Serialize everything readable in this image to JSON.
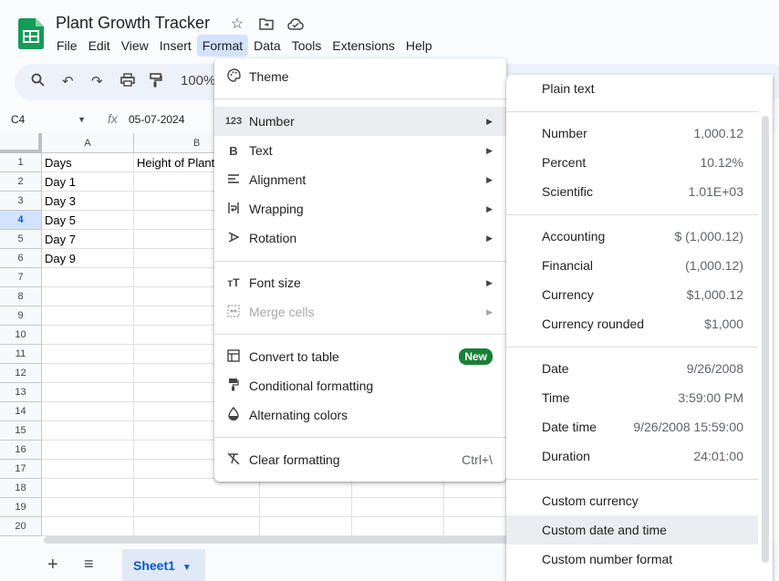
{
  "app": {
    "title": "Plant Growth Tracker",
    "menus": [
      "File",
      "Edit",
      "View",
      "Insert",
      "Format",
      "Data",
      "Tools",
      "Extensions",
      "Help"
    ],
    "active_menu": "Format",
    "brand_color": "#0f9d58"
  },
  "toolbar": {
    "zoom": "100%"
  },
  "formula_bar": {
    "cell_ref": "C4",
    "fx": "fx",
    "value": "05-07-2024"
  },
  "sheet": {
    "columns": [
      "A",
      "B"
    ],
    "rows": [
      "1",
      "2",
      "3",
      "4",
      "5",
      "6",
      "7",
      "8",
      "9",
      "10",
      "11",
      "12",
      "13",
      "14",
      "15",
      "16",
      "17",
      "18",
      "19",
      "20"
    ],
    "selected_row": "4",
    "cells": {
      "a1": "Days",
      "b1": "Height of Plant",
      "a2": "Day 1",
      "a3": "Day 3",
      "a4": "Day 5",
      "a5": "Day 7",
      "a6": "Day 9"
    }
  },
  "sheet_tabs": {
    "add": "+",
    "list": "≡",
    "active": "Sheet1"
  },
  "format_menu": {
    "theme": "Theme",
    "number": "Number",
    "text": "Text",
    "alignment": "Alignment",
    "wrapping": "Wrapping",
    "rotation": "Rotation",
    "font_size": "Font size",
    "merge_cells": "Merge cells",
    "convert_to_table": "Convert to table",
    "new_badge": "New",
    "conditional_formatting": "Conditional formatting",
    "alternating_colors": "Alternating colors",
    "clear_formatting": "Clear formatting",
    "clear_shortcut": "Ctrl+\\"
  },
  "number_submenu": {
    "plain_text": "Plain text",
    "number": {
      "label": "Number",
      "value": "1,000.12"
    },
    "percent": {
      "label": "Percent",
      "value": "10.12%"
    },
    "scientific": {
      "label": "Scientific",
      "value": "1.01E+03"
    },
    "accounting": {
      "label": "Accounting",
      "value": "$ (1,000.12)"
    },
    "financial": {
      "label": "Financial",
      "value": "(1,000.12)"
    },
    "currency": {
      "label": "Currency",
      "value": "$1,000.12"
    },
    "currency_rounded": {
      "label": "Currency rounded",
      "value": "$1,000"
    },
    "date": {
      "label": "Date",
      "value": "9/26/2008"
    },
    "time": {
      "label": "Time",
      "value": "3:59:00 PM"
    },
    "date_time": {
      "label": "Date time",
      "value": "9/26/2008 15:59:00"
    },
    "duration": {
      "label": "Duration",
      "value": "24:01:00"
    },
    "custom_currency": "Custom currency",
    "custom_date_time": "Custom date and time",
    "custom_number_format": "Custom number format"
  }
}
